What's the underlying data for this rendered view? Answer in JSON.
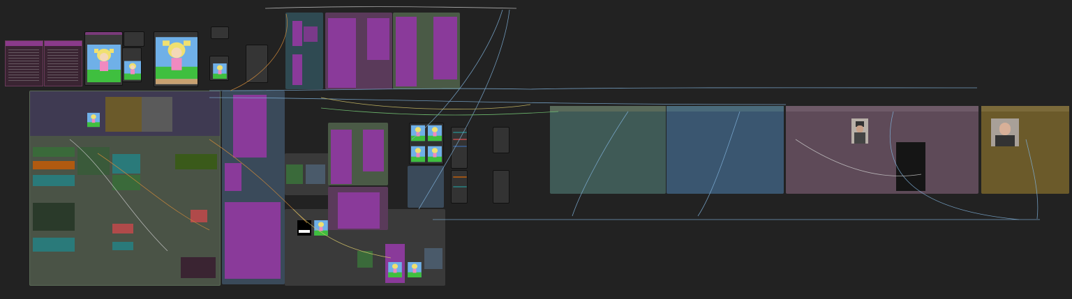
{
  "app": {
    "name": "node-graph-editor"
  },
  "colors": {
    "background": "#222222",
    "node": "#353535",
    "group_green": "#4a5a46",
    "group_teal": "#3f5f5f",
    "group_blue": "#3a5670",
    "group_pink": "#5e4a58",
    "group_gold": "#6b5a2a",
    "group_purple": "#5a3a6a",
    "node_magenta": "#8a3a9a",
    "wire_blue": "#7fb0d8",
    "wire_orange": "#d08a3a",
    "wire_yellow": "#d8c86a",
    "wire_green": "#7ad07a",
    "wire_white": "#c8c8c8"
  },
  "icons": {
    "cartoon_character_preview": "cartoon-character-image",
    "person_photo_preview": "person-photo-image",
    "mask_preview": "black-white-mask-image"
  }
}
